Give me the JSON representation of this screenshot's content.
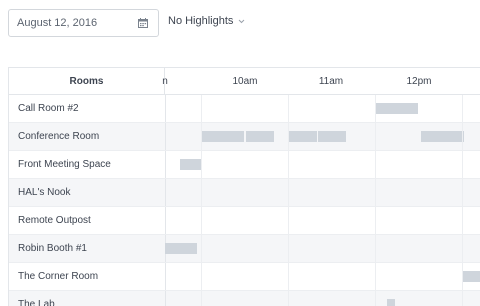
{
  "toolbar": {
    "date_value": "August 12, 2016",
    "highlight_label": "No Highlights"
  },
  "table": {
    "rooms_header": "Rooms",
    "hours": [
      {
        "label": "n"
      },
      {
        "label": "10am"
      },
      {
        "label": "11am"
      },
      {
        "label": "12pm"
      }
    ]
  },
  "rooms": [
    {
      "name": "Call Room #2"
    },
    {
      "name": "Conference Room"
    },
    {
      "name": "Front Meeting Space"
    },
    {
      "name": "HAL's Nook"
    },
    {
      "name": "Remote Outpost"
    },
    {
      "name": "Robin Booth #1"
    },
    {
      "name": "The Corner Room"
    },
    {
      "name": "The Lab"
    }
  ],
  "colors": {
    "booking": "#cfd5dc",
    "row_alt": "#f5f6f8",
    "border": "#e3e6ea"
  }
}
